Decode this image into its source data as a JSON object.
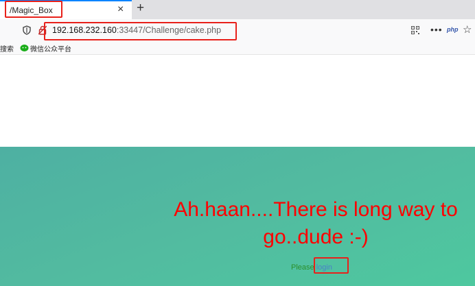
{
  "browser": {
    "tab_title": "/Magic_Box",
    "tab_close": "×",
    "new_tab": "+",
    "url_host": "192.168.232.160",
    "url_rest": ":33447/Challenge/cake.php",
    "menu_dots": "•••",
    "php_badge": "php",
    "star": "☆"
  },
  "bookmarks": {
    "search": "搜索",
    "wechat": "微信公众平台"
  },
  "page": {
    "headline_line1": "Ah.haan....There is long way to",
    "headline_line2": "go..dude :-)",
    "please": "Please ",
    "login_link": "login"
  },
  "colors": {
    "headline": "#ff0000",
    "annotation": "#e8201a",
    "background_green": "#52bba0"
  }
}
